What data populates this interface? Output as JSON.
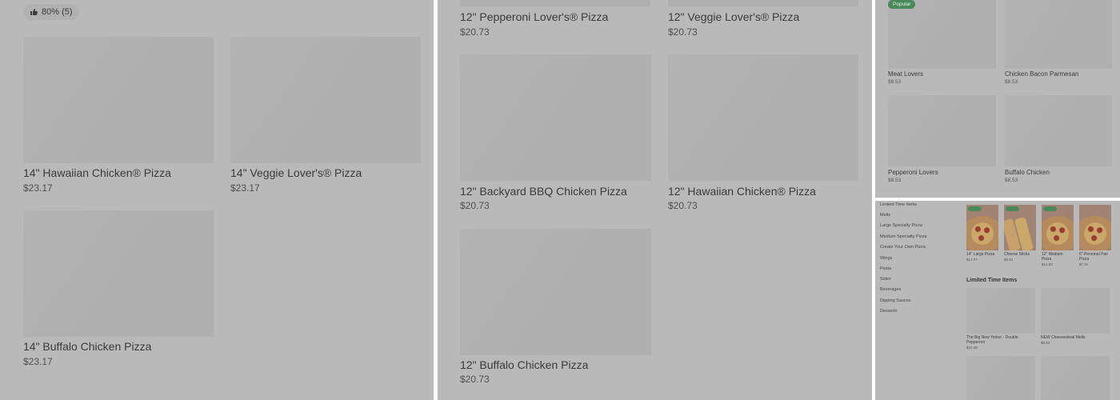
{
  "panel_a": {
    "rating": {
      "text": "80% (5)",
      "icon": "thumbs-up-icon"
    },
    "items": [
      {
        "name": "14\" Hawaiian Chicken® Pizza",
        "price": "$23.17"
      },
      {
        "name": "14\" Veggie Lover's® Pizza",
        "price": "$23.17"
      },
      {
        "name": "14\" Buffalo Chicken Pizza",
        "price": "$23.17"
      }
    ]
  },
  "panel_b": {
    "items": [
      {
        "name": "12\" Pepperoni Lover's® Pizza",
        "price": "$20.73"
      },
      {
        "name": "12\" Veggie Lover's® Pizza",
        "price": "$20.73"
      },
      {
        "name": "12\" Backyard BBQ Chicken Pizza",
        "price": "$20.73"
      },
      {
        "name": "12\" Hawaiian Chicken® Pizza",
        "price": "$20.73"
      },
      {
        "name": "12\" Buffalo Chicken Pizza",
        "price": "$20.73"
      }
    ]
  },
  "panel_c": {
    "badge": "Popular",
    "items": [
      {
        "name": "Meat Lovers",
        "price": "$8.53"
      },
      {
        "name": "Chicken Bacon Parmesan",
        "price": "$8.53"
      },
      {
        "name": "Pepperoni Lovers",
        "price": "$8.53"
      },
      {
        "name": "Buffalo Chicken",
        "price": "$8.53"
      }
    ]
  },
  "panel_d": {
    "nav": [
      "Limited Time Items",
      "Melts",
      "Large Specialty Pizza",
      "Medium Specialty Pizza",
      "Create Your Own Pizza",
      "Wings",
      "Pasta",
      "Sides",
      "Beverages",
      "Dipping Sauces",
      "Desserts"
    ],
    "featured": [
      {
        "name": "14\" Large Pizza",
        "price": "$17.07"
      },
      {
        "name": "Cheese Sticks",
        "price": "$8.53"
      },
      {
        "name": "12\" Medium Pizza",
        "price": "$14.63"
      },
      {
        "name": "6\" Personal Pan Pizza",
        "price": "$7.31"
      }
    ],
    "section_title": "Limited Time Items",
    "limited": [
      {
        "name": "The Big New Yorker - Double Pepperoni",
        "price": "$24.39"
      },
      {
        "name": "NEW Cheesesteak Melts",
        "price": "$8.53"
      }
    ]
  }
}
